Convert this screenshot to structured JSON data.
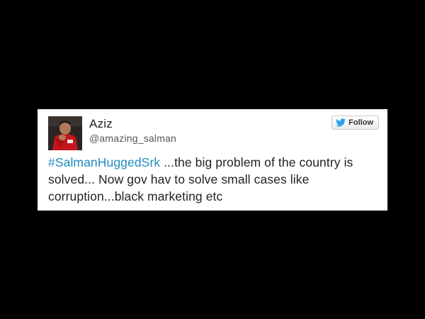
{
  "tweet": {
    "author_name": "Aziz",
    "author_handle": "@amazing_salman",
    "hashtag": "#SalmanHuggedSrk",
    "body": " ...the big problem of the country is solved... Now gov hav to solve small cases like corruption...black marketing etc"
  },
  "follow_button": {
    "label": "Follow",
    "icon": "twitter-bird-icon"
  },
  "colors": {
    "background": "#000000",
    "card": "#ffffff",
    "hashtag": "#1f8bbf",
    "twitter_blue": "#2aa3ef",
    "text": "#222222",
    "handle": "#555555"
  }
}
